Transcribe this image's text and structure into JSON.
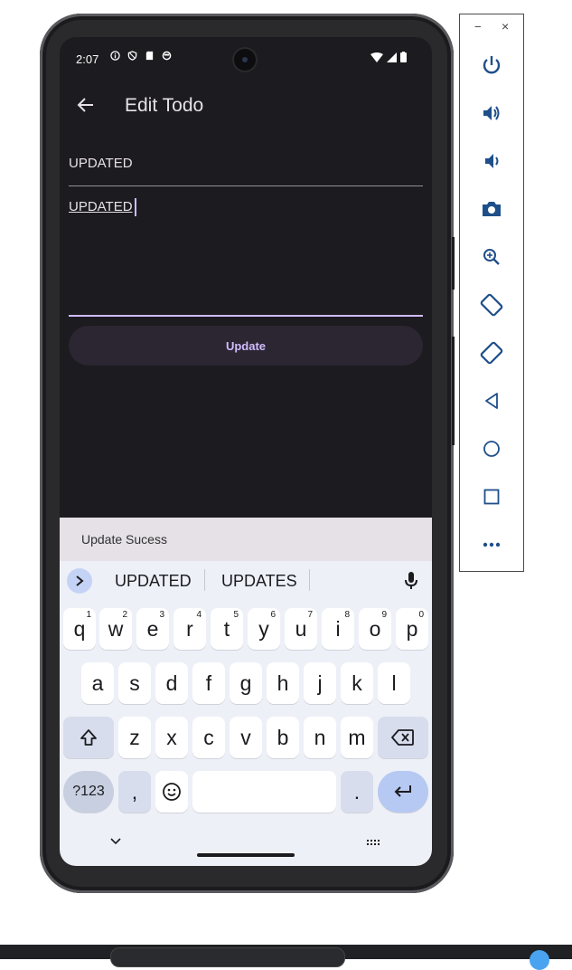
{
  "status_bar": {
    "time": "2:07"
  },
  "app_bar": {
    "title": "Edit Todo"
  },
  "form": {
    "title_value": "UPDATED",
    "description_value": "UPDATED",
    "update_button_label": "Update"
  },
  "snackbar": {
    "message": "Update Sucess"
  },
  "keyboard": {
    "suggestions": [
      "UPDATED",
      "UPDATES"
    ],
    "row1": [
      {
        "key": "q",
        "hint": "1"
      },
      {
        "key": "w",
        "hint": "2"
      },
      {
        "key": "e",
        "hint": "3"
      },
      {
        "key": "r",
        "hint": "4"
      },
      {
        "key": "t",
        "hint": "5"
      },
      {
        "key": "y",
        "hint": "6"
      },
      {
        "key": "u",
        "hint": "7"
      },
      {
        "key": "i",
        "hint": "8"
      },
      {
        "key": "o",
        "hint": "9"
      },
      {
        "key": "p",
        "hint": "0"
      }
    ],
    "row2": [
      "a",
      "s",
      "d",
      "f",
      "g",
      "h",
      "j",
      "k",
      "l"
    ],
    "row3": [
      "z",
      "x",
      "c",
      "v",
      "b",
      "n",
      "m"
    ],
    "symbols_key": "?123",
    "comma_key": ",",
    "period_key": "."
  },
  "colors": {
    "screen_bg": "#1c1b1f",
    "accent": "#d0bcff",
    "snackbar_bg": "#e5e1e6",
    "keyboard_bg": "#eef0f8",
    "enter_key": "#b6c9f2"
  },
  "toolbar": {
    "minimize_label": "−",
    "close_label": "×",
    "buttons": [
      "power-icon",
      "volume-up-icon",
      "volume-down-icon",
      "camera-icon",
      "zoom-icon",
      "rotate-left-icon",
      "rotate-right-icon",
      "back-icon",
      "home-icon",
      "overview-icon",
      "more-icon"
    ]
  }
}
